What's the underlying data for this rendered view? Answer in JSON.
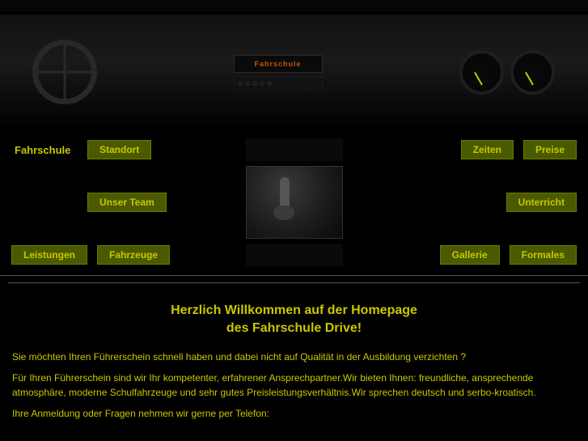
{
  "header": {
    "radio_text": "Fahrschule",
    "alt": "Car dashboard interior image"
  },
  "nav": {
    "fahrschule_label": "Fahrschule",
    "standort_label": "Standort",
    "unser_team_label": "Unser Team",
    "unterricht_label": "Unterricht",
    "leistungen_label": "Leistungen",
    "fahrzeuge_label": "Fahrzeuge",
    "zeiten_label": "Zeiten",
    "preise_label": "Preise",
    "gallerie_label": "Gallerie",
    "formales_label": "Formales"
  },
  "main": {
    "title_line1": "Herzlich Willkommen auf der Homepage",
    "title_line2": "des Fahrschule Drive!",
    "paragraph1": "Sie möchten Ihren Führerschein schnell haben und dabei nicht auf Qualität in der Ausbildung verzichten ?",
    "paragraph2": "Für Ihren Führerschein sind wir Ihr kompetenter, erfahrener Ansprechpartner.Wir bieten Ihnen: freundliche, ansprechende atmosphäre, moderne Schulfahrzeuge und sehr gutes Preisleistungsverhältnis.Wir sprechen deutsch und serbo-kroatisch.",
    "paragraph3": "Ihre Anmeldung oder Fragen nehmen wir gerne per Telefon:"
  }
}
